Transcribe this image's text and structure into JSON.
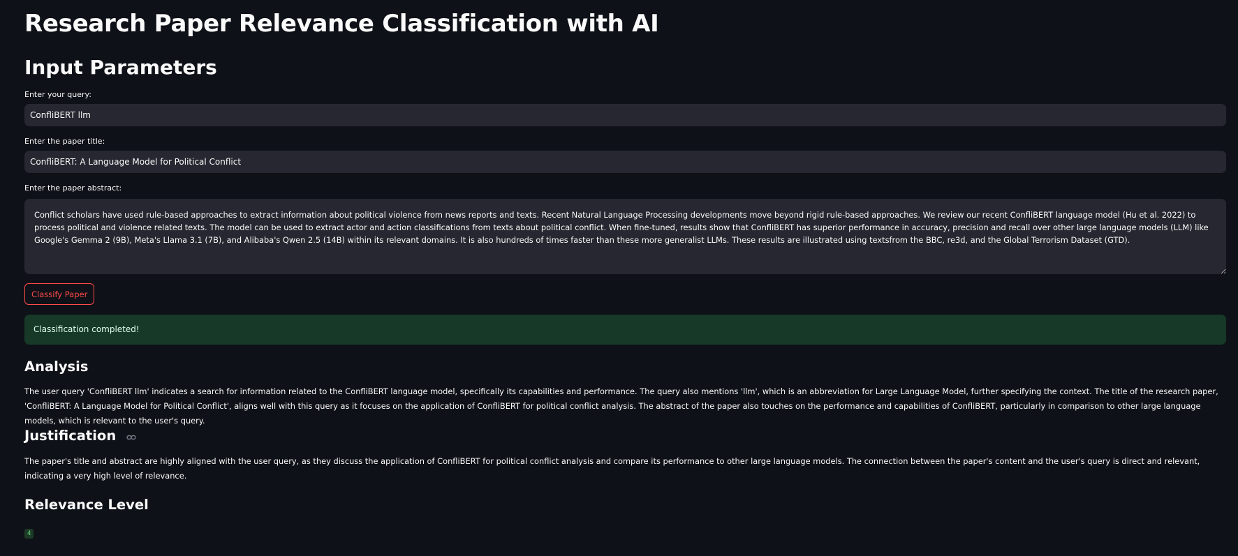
{
  "page": {
    "title": "Research Paper Relevance Classification with AI",
    "section_title": "Input Parameters"
  },
  "query": {
    "label": "Enter your query:",
    "value": "ConfliBERT llm"
  },
  "paper_title": {
    "label": "Enter the paper title:",
    "value": "ConfliBERT: A Language Model for Political Conflict"
  },
  "abstract": {
    "label": "Enter the paper abstract:",
    "value": "Conflict scholars have used rule-based approaches to extract information about political violence from news reports and texts. Recent Natural Language Processing developments move beyond rigid rule-based approaches. We review our recent ConfliBERT language model (Hu et al. 2022) to process political and violence related texts. The model can be used to extract actor and action classifications from texts about political conflict. When fine-tuned, results show that ConfliBERT has superior performance in accuracy, precision and recall over other large language models (LLM) like Google's Gemma 2 (9B), Meta's Llama 3.1 (7B), and Alibaba's Qwen 2.5 (14B) within its relevant domains. It is also hundreds of times faster than these more generalist LLMs. These results are illustrated using textsfrom the BBC, re3d, and the Global Terrorism Dataset (GTD)."
  },
  "classify_button": {
    "label": "Classify Paper"
  },
  "status": {
    "message": "Classification completed!"
  },
  "analysis": {
    "heading": "Analysis",
    "text": "The user query 'ConfliBERT llm' indicates a search for information related to the ConfliBERT language model, specifically its capabilities and performance. The query also mentions 'llm', which is an abbreviation for Large Language Model, further specifying the context. The title of the research paper, 'ConfliBERT: A Language Model for Political Conflict', aligns well with this query as it focuses on the application of ConfliBERT for political conflict analysis. The abstract of the paper also touches on the performance and capabilities of ConfliBERT, particularly in comparison to other large language models, which is relevant to the user's query."
  },
  "justification": {
    "heading": "Justification",
    "text": "The paper's title and abstract are highly aligned with the user query, as they discuss the application of ConfliBERT for political conflict analysis and compare its performance to other large language models. The connection between the paper's content and the user's query is direct and relevant, indicating a very high level of relevance."
  },
  "relevance": {
    "heading": "Relevance Level",
    "value": "4"
  },
  "colors": {
    "background": "#0e1117",
    "input_background": "#262730",
    "accent": "#ff4b4b",
    "success_background": "#173928",
    "success_text": "#dffde9"
  }
}
